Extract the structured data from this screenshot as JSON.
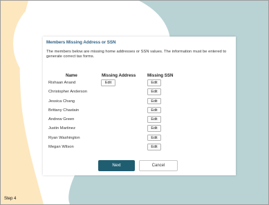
{
  "dialog": {
    "title": "Members Missing Address or SSN",
    "description": "The members below are missing home addresses or SSN values. The information must be entered to generate correct tax forms.",
    "columns": {
      "name": "Name",
      "missing_address": "Missing Address",
      "missing_ssn": "Missing SSN"
    },
    "rows": [
      {
        "name": "Rishaan Anand",
        "address_action": "Edit",
        "ssn_action": "Edit"
      },
      {
        "name": "Christopher Anderson",
        "address_action": null,
        "ssn_action": "Edit"
      },
      {
        "name": "Jessica Chang",
        "address_action": null,
        "ssn_action": "Edit"
      },
      {
        "name": "Brittany Chastain",
        "address_action": null,
        "ssn_action": "Edit"
      },
      {
        "name": "Andrew Green",
        "address_action": null,
        "ssn_action": "Edit"
      },
      {
        "name": "Justin Martinez",
        "address_action": null,
        "ssn_action": "Edit"
      },
      {
        "name": "Ryan Washington",
        "address_action": null,
        "ssn_action": "Edit"
      },
      {
        "name": "Megan Wilson",
        "address_action": null,
        "ssn_action": "Edit"
      }
    ],
    "next_label": "Next",
    "cancel_label": "Cancel"
  },
  "footer": {
    "step_label": "Step 4"
  },
  "colors": {
    "primary_button": "#1f5d70",
    "title_text": "#2e5f82",
    "background_teal": "#b9d3d5",
    "background_peach": "#fde7bf"
  }
}
